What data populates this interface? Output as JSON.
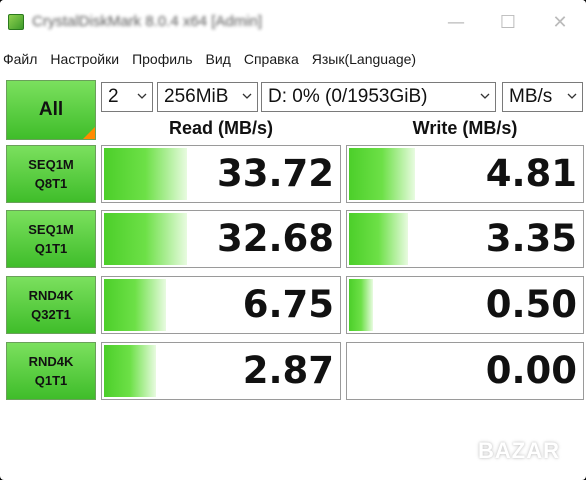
{
  "window": {
    "title": "CrystalDiskMark 8.0.4 x64 [Admin]",
    "controls": {
      "minimize": "—",
      "maximize": "☐",
      "close": "✕"
    }
  },
  "menu": [
    "Файл",
    "Настройки",
    "Профиль",
    "Вид",
    "Справка",
    "Язык(Language)"
  ],
  "toolbar": {
    "all_label": "All",
    "count": "2",
    "size": "256MiB",
    "drive": "D: 0% (0/1953GiB)",
    "unit": "MB/s"
  },
  "headers": {
    "read": "Read (MB/s)",
    "write": "Write (MB/s)"
  },
  "tests": [
    {
      "line1": "SEQ1M",
      "line2": "Q8T1",
      "read": "33.72",
      "write": "4.81",
      "read_fill": 0.35,
      "write_fill": 0.28
    },
    {
      "line1": "SEQ1M",
      "line2": "Q1T1",
      "read": "32.68",
      "write": "3.35",
      "read_fill": 0.35,
      "write_fill": 0.25
    },
    {
      "line1": "RND4K",
      "line2": "Q32T1",
      "read": "6.75",
      "write": "0.50",
      "read_fill": 0.26,
      "write_fill": 0.1
    },
    {
      "line1": "RND4K",
      "line2": "Q1T1",
      "read": "2.87",
      "write": "0.00",
      "read_fill": 0.22,
      "write_fill": 0.0
    }
  ],
  "watermark": "BAZAR",
  "colors": {
    "accent_green": "#4ccf2a",
    "corner_orange": "#ff8a00"
  }
}
